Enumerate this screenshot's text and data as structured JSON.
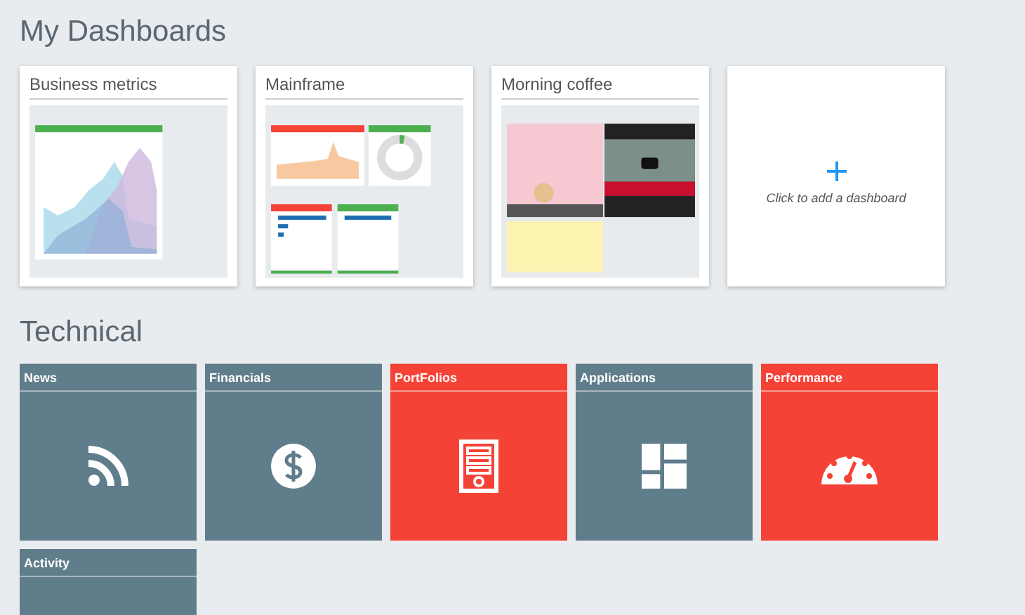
{
  "dashboards_section": {
    "title": "My Dashboards"
  },
  "dashboards": [
    {
      "title": "Business metrics",
      "preview": {
        "kind": "area-chart"
      }
    },
    {
      "title": "Mainframe",
      "preview": {
        "kind": "widgets"
      }
    },
    {
      "title": "Morning coffee",
      "preview": {
        "kind": "media"
      }
    }
  ],
  "add_dashboard": {
    "label": "Click to add a dashboard"
  },
  "technical_section": {
    "title": "Technical"
  },
  "tiles": [
    {
      "label": "News",
      "kind": "feed",
      "color": "#607d8b"
    },
    {
      "label": "Financials",
      "kind": "money",
      "color": "#607d8b"
    },
    {
      "label": "PortFolios",
      "kind": "doc",
      "color": "#f44336"
    },
    {
      "label": "Applications",
      "kind": "layout",
      "color": "#607d8b"
    },
    {
      "label": "Performance",
      "kind": "meter",
      "color": "#f44336"
    },
    {
      "label": "Activity",
      "kind": "plain",
      "color": "#607d8b"
    }
  ]
}
